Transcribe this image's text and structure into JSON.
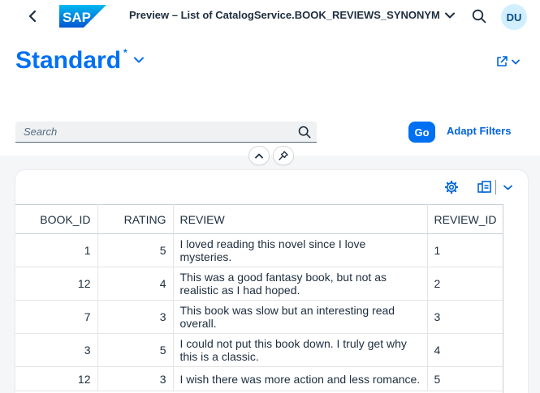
{
  "shell": {
    "logo_text": "SAP",
    "title": "Preview – List of CatalogService.BOOK_REVIEWS_SYNONYM",
    "avatar": "DU"
  },
  "header": {
    "variant_name": "Standard",
    "variant_dirty_marker": "*",
    "search_placeholder": "Search",
    "go_label": "Go",
    "adapt_filters_label": "Adapt Filters"
  },
  "table": {
    "columns": [
      "BOOK_ID",
      "RATING",
      "REVIEW",
      "REVIEW_ID"
    ],
    "rows": [
      {
        "book_id": "1",
        "rating": "5",
        "review": "I loved reading this novel since I love mysteries.",
        "review_id": "1"
      },
      {
        "book_id": "12",
        "rating": "4",
        "review": "This was a good fantasy book, but not as realistic as I had hoped.",
        "review_id": "2"
      },
      {
        "book_id": "7",
        "rating": "3",
        "review": "This book was slow but an interesting read overall.",
        "review_id": "3"
      },
      {
        "book_id": "3",
        "rating": "5",
        "review": "I could not put this book down. I truly get why this is a classic.",
        "review_id": "4"
      },
      {
        "book_id": "12",
        "rating": "3",
        "review": "I wish there was more action and less romance.",
        "review_id": "5"
      }
    ]
  },
  "icons": {
    "back": "chevron-left-icon",
    "title_menu": "chevron-down-icon",
    "shell_search": "search-icon",
    "variant_menu": "chevron-down-icon",
    "share": "share-icon",
    "search": "search-icon",
    "collapse_header": "chevron-up-icon",
    "pin_header": "pin-icon",
    "table_settings": "gear-icon",
    "export": "export-icon",
    "export_menu": "chevron-down-icon"
  },
  "colors": {
    "brand_blue": "#0070f2",
    "link_blue": "#0064d9",
    "text": "#1d2d3e",
    "avatar_bg": "#d1efff",
    "page_bg": "#f5f6f7"
  }
}
